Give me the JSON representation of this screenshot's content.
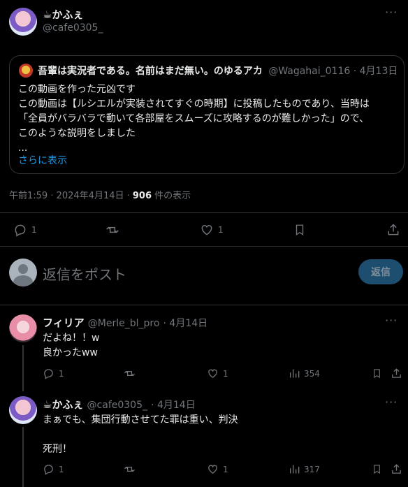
{
  "main_post": {
    "display_name": "☕かふぇ",
    "handle": "@cafe0305_",
    "meta_time": "午前1:59 · 2024年4月14日 · ",
    "views_count": "906",
    "views_label": " 件の表示",
    "actions": {
      "reply_count": "1",
      "like_count": "1"
    }
  },
  "quote": {
    "author_name": "吾輩は実況者である。名前はまだ無い。のゆるアカ",
    "author_handle": "@Wagahai_0116",
    "date": "· 4月13日",
    "lines": [
      "この動画を作った元凶です",
      "この動画は【ルシエルが実装されてすぐの時期】に投稿したものであり、当時は",
      "「全員がバラバラで動いて各部屋をスムーズに攻略するのが難しかった」ので、",
      "このような説明をしました",
      "..."
    ],
    "show_more": "さらに表示"
  },
  "composer": {
    "placeholder": "返信をポスト",
    "submit_label": "返信"
  },
  "replies": [
    {
      "display_name": "フィリア",
      "handle": "@Merle_bl_pro",
      "date": "· 4月14日",
      "lines": [
        "だよね！！w",
        "良かったww"
      ],
      "reply_count": "1",
      "like_count": "1",
      "views": "354"
    },
    {
      "display_name": "☕かふぇ",
      "handle": "@cafe0305_",
      "date": "· 4月14日",
      "lines": [
        "まぁでも、集団行動させてた罪は重い、判決",
        "",
        "死刑！"
      ],
      "reply_count": "1",
      "like_count": "1",
      "views": "317"
    }
  ],
  "icons": [
    "more-icon",
    "reply-icon",
    "retweet-icon",
    "like-icon",
    "bookmark-icon",
    "share-icon",
    "views-icon"
  ]
}
